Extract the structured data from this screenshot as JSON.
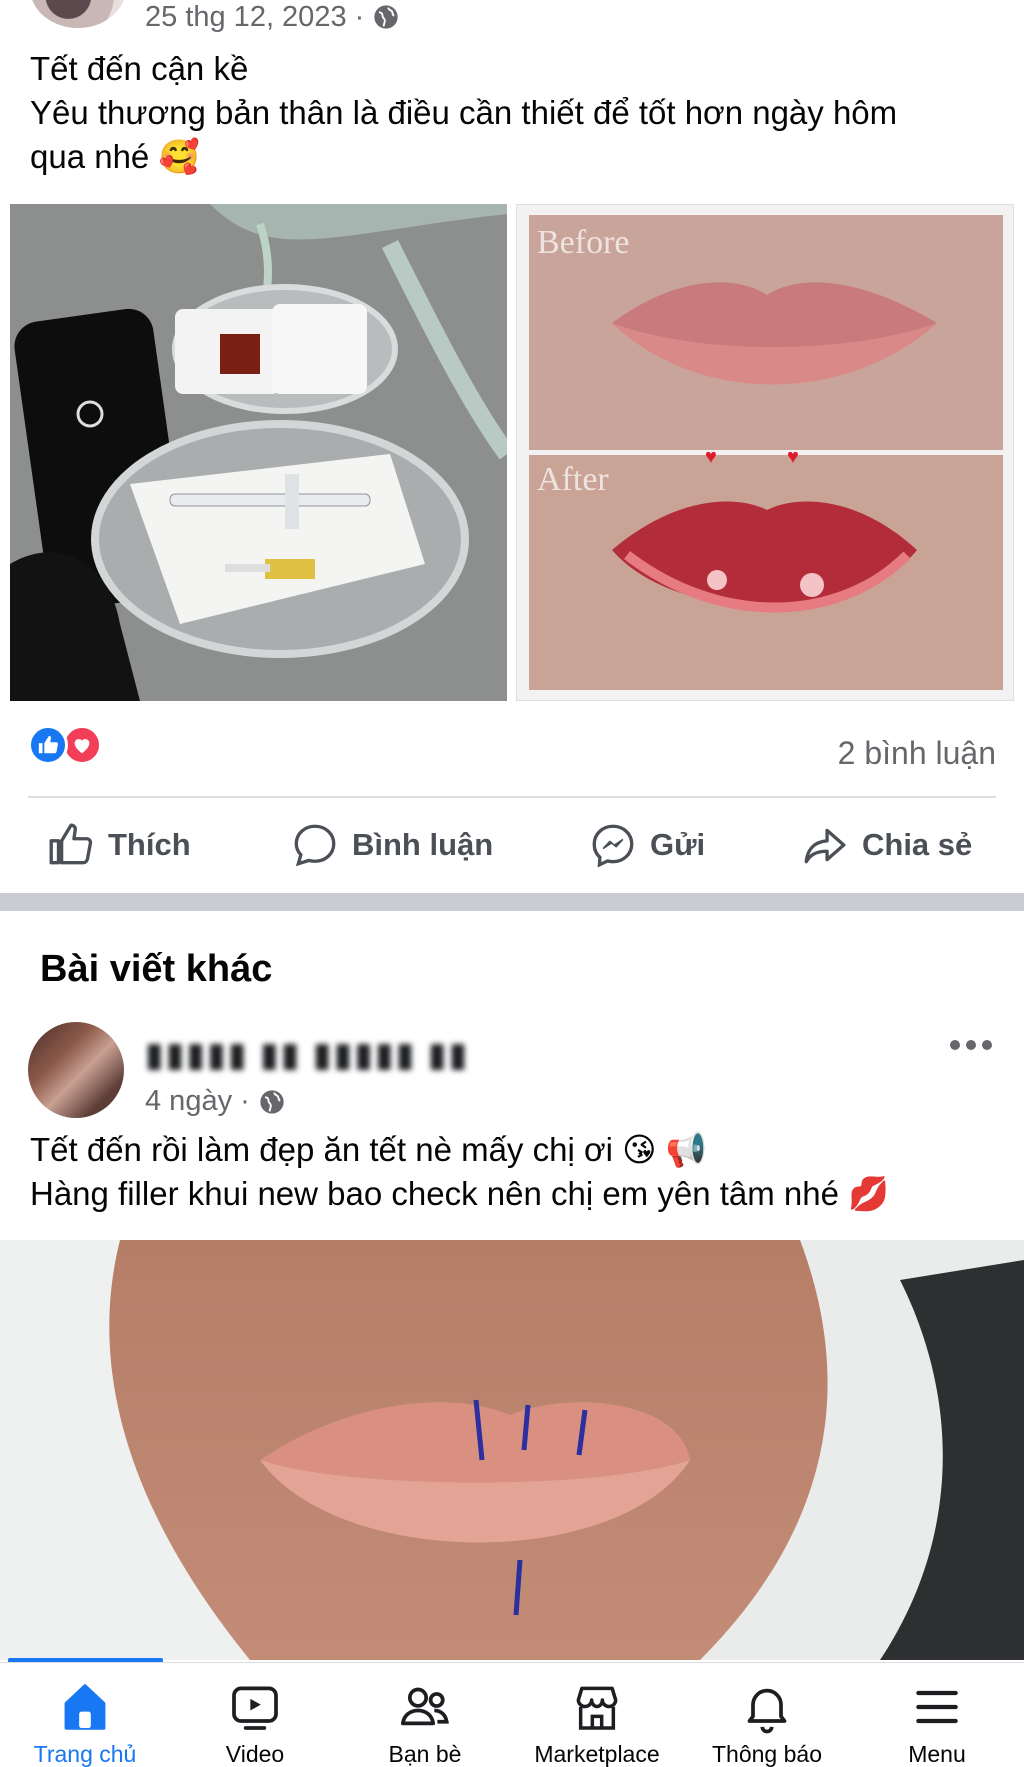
{
  "post1": {
    "date": "25 thg 12, 2023",
    "text_line1": "Tết đến cận kề",
    "text_line2": "Yêu thương bản thân là điều cần thiết để tốt hơn ngày hôm",
    "text_line3": "qua nhé 🥰",
    "image_right_before_label": "Before",
    "image_right_after_label": "After",
    "comment_count": "2 bình luận"
  },
  "actions": {
    "like": "Thích",
    "comment": "Bình luận",
    "send": "Gửi",
    "share": "Chia sẻ"
  },
  "other_posts": {
    "title": "Bài viết khác"
  },
  "post2": {
    "author_name": "▮▮▮▮▮ ▮▮ ▮▮▮▮▮ ▮▮",
    "time": "4 ngày",
    "text_line1": "Tết đến rồi làm đẹp ăn tết nè mấy chị ơi 😘 📢",
    "text_line2": "Hàng filler khui new bao check nên chị em yên tâm nhé 💋"
  },
  "bottom_nav": {
    "items": [
      {
        "label": "Trang chủ",
        "icon": "home-icon",
        "active": true
      },
      {
        "label": "Video",
        "icon": "video-icon"
      },
      {
        "label": "Bạn bè",
        "icon": "friends-icon"
      },
      {
        "label": "Marketplace",
        "icon": "marketplace-icon"
      },
      {
        "label": "Thông báo",
        "icon": "bell-icon"
      },
      {
        "label": "Menu",
        "icon": "menu-icon"
      }
    ]
  },
  "colors": {
    "accent": "#1877f2",
    "secondary_text": "#65676b",
    "love": "#f33e58"
  }
}
